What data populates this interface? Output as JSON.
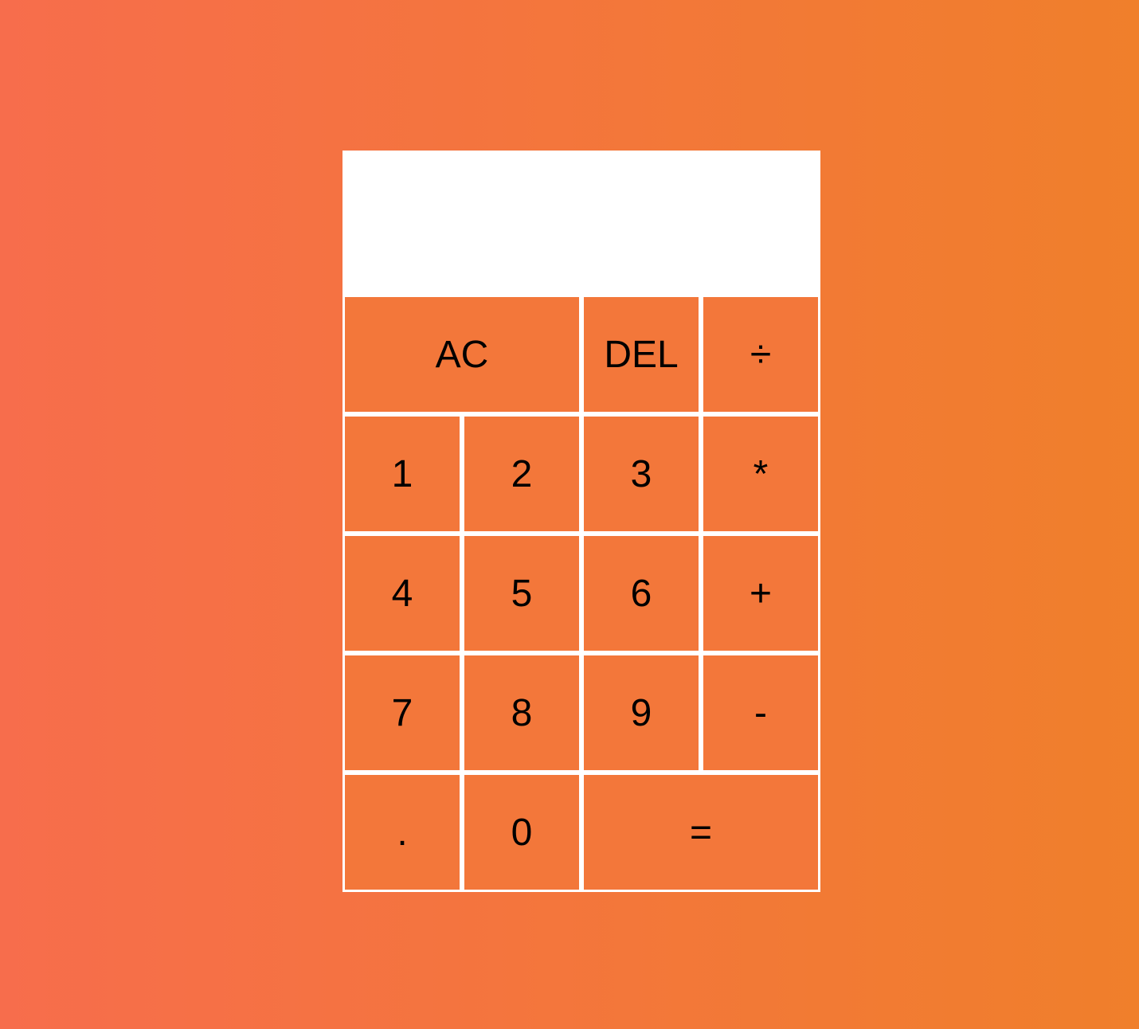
{
  "display": {
    "previous_operand": "",
    "current_operand": ""
  },
  "keys": {
    "all_clear": "AC",
    "delete": "DEL",
    "divide": "÷",
    "one": "1",
    "two": "2",
    "three": "3",
    "multiply": "*",
    "four": "4",
    "five": "5",
    "six": "6",
    "add": "+",
    "seven": "7",
    "eight": "8",
    "nine": "9",
    "subtract": "-",
    "decimal": ".",
    "zero": "0",
    "equals": "="
  },
  "colors": {
    "background_start": "#f76d4c",
    "background_end": "#f07f2b",
    "key_background": "#f3773a",
    "key_border": "#ffffff",
    "display_background": "#ffffff"
  }
}
